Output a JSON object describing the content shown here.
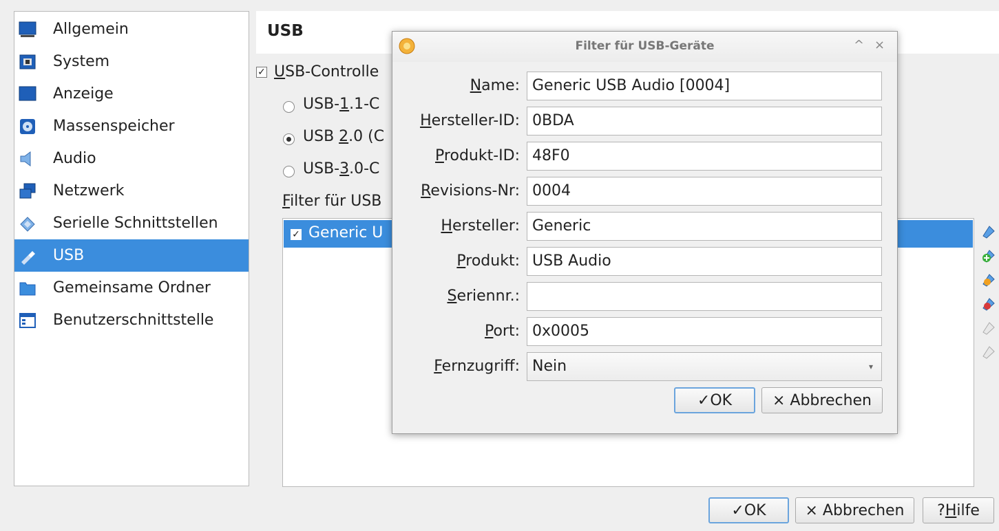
{
  "sidebar": {
    "items": [
      {
        "label": "Allgemein",
        "icon": "general-icon"
      },
      {
        "label": "System",
        "icon": "system-icon"
      },
      {
        "label": "Anzeige",
        "icon": "display-icon"
      },
      {
        "label": "Massenspeicher",
        "icon": "storage-icon"
      },
      {
        "label": "Audio",
        "icon": "audio-icon"
      },
      {
        "label": "Netzwerk",
        "icon": "network-icon"
      },
      {
        "label": "Serielle Schnittstellen",
        "icon": "serial-ports-icon"
      },
      {
        "label": "USB",
        "icon": "usb-icon",
        "selected": true
      },
      {
        "label": "Gemeinsame Ordner",
        "icon": "shared-folders-icon"
      },
      {
        "label": "Benutzerschnittstelle",
        "icon": "user-interface-icon"
      }
    ]
  },
  "page": {
    "title": "USB",
    "controller_checkbox": {
      "label_first": "U",
      "label_rest": "SB-Controlle",
      "checked": true
    },
    "radios": [
      {
        "pre": "USB-",
        "ul": "1",
        "post": ".1-C",
        "selected": false
      },
      {
        "pre": "USB ",
        "ul": "2",
        "post": ".0 (C",
        "selected": true
      },
      {
        "pre": "USB-",
        "ul": "3",
        "post": ".0-C",
        "selected": false
      }
    ],
    "filters_label_first": "F",
    "filters_label_rest": "ilter für USB",
    "filter_items": [
      {
        "label": "Generic U",
        "checked": true
      }
    ],
    "toolbar_icons": [
      "add-filter-icon",
      "add-from-device-icon",
      "edit-filter-icon",
      "remove-filter-icon",
      "move-up-icon",
      "move-down-icon"
    ]
  },
  "dialog": {
    "title": "Filter für USB-Geräte",
    "controls": {
      "minimize": "^",
      "close": "×"
    },
    "fields": [
      {
        "key": "name",
        "ul": "N",
        "rest": "ame:",
        "value": ""
      },
      {
        "key": "vendor_id",
        "ul": "H",
        "rest": "ersteller-ID:",
        "value": ""
      },
      {
        "key": "product_id",
        "ul": "P",
        "rest": "rodukt-ID:",
        "value": ""
      },
      {
        "key": "revision",
        "ul": "R",
        "rest": "evisions-Nr:",
        "value": ""
      },
      {
        "key": "manufacturer",
        "ul": "H",
        "rest": "ersteller:",
        "value": ""
      },
      {
        "key": "product",
        "ul": "P",
        "rest": "rodukt:",
        "value": ""
      },
      {
        "key": "serial",
        "ul": "S",
        "rest": "eriennr.:",
        "value": ""
      },
      {
        "key": "port",
        "ul": "P",
        "rest": "ort:",
        "value": ""
      },
      {
        "key": "remote",
        "ul": "F",
        "rest": "ernzugriff:",
        "value": ""
      }
    ],
    "values": {
      "name": "Generic USB Audio [0004]",
      "vendor_id": "0BDA",
      "product_id": "48F0",
      "revision": "0004",
      "manufacturer": "Generic",
      "product": "USB Audio",
      "serial": "",
      "port": "0x0005",
      "remote": "Nein"
    },
    "ok_label": "✓OK",
    "cancel_label": "× Abbrechen"
  },
  "footer": {
    "ok_label": "✓OK",
    "cancel_label": "× Abbrechen",
    "help_pre": "? ",
    "help_ul": "H",
    "help_rest": "ilfe"
  },
  "colors": {
    "selection": "#3b8ddd",
    "background": "#efefef"
  }
}
